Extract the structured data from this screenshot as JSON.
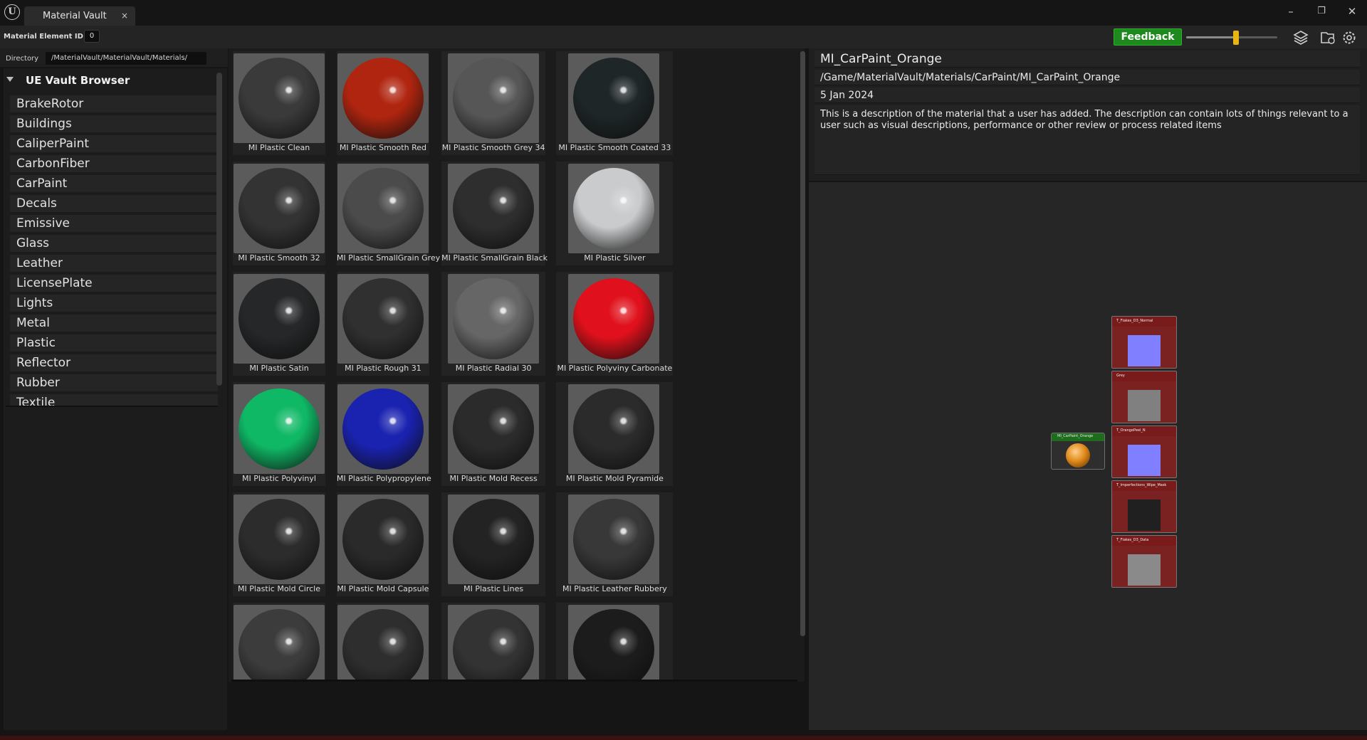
{
  "window": {
    "tab_title": "Material Vault",
    "tab_close": "×",
    "controls": {
      "minimize": "–",
      "restore": "❐",
      "close": "✕"
    }
  },
  "toolbar": {
    "material_element_id_label": "Material Element ID :",
    "material_element_id_value": "0",
    "feedback_label": "Feedback",
    "zoom_slider_level": 0.55
  },
  "directory": {
    "label": "Directory",
    "value": "/MaterialVault/MaterialVault/Materials/"
  },
  "sidebar": {
    "title": "UE Vault Browser",
    "items": [
      "BrakeRotor",
      "Buildings",
      "CaliperPaint",
      "CarbonFiber",
      "CarPaint",
      "Decals",
      "Emissive",
      "Glass",
      "Leather",
      "LicensePlate",
      "Lights",
      "Metal",
      "Plastic",
      "Reflector",
      "Rubber",
      "Textile"
    ]
  },
  "grid": {
    "rows": [
      [
        {
          "label": "MI Plastic Clean",
          "color": "#3a3a3a"
        },
        {
          "label": "MI Plastic Smooth Red",
          "color": "#b0250f"
        },
        {
          "label": "MI Plastic Smooth Grey 34",
          "color": "#565656"
        },
        {
          "label": "MI Plastic Smooth Coated 33",
          "color": "#1e2628"
        }
      ],
      [
        {
          "label": "MI Plastic Smooth 32",
          "color": "#333333"
        },
        {
          "label": "MI Plastic SmallGrain Grey",
          "color": "#4b4b4b"
        },
        {
          "label": "MI Plastic SmallGrain Black",
          "color": "#2e2e2e"
        },
        {
          "label": "MI Plastic Silver",
          "color": "#c9cbcc"
        }
      ],
      [
        {
          "label": "MI Plastic Satin",
          "color": "#252728"
        },
        {
          "label": "MI Plastic Rough 31",
          "color": "#303030"
        },
        {
          "label": "MI Plastic Radial 30",
          "color": "#666666"
        },
        {
          "label": "MI Plastic Polyviny Carbonate",
          "color": "#e0111c"
        }
      ],
      [
        {
          "label": "MI Plastic Polyvinyl",
          "color": "#0fb865"
        },
        {
          "label": "MI Plastic Polypropylene",
          "color": "#1a22b0"
        },
        {
          "label": "MI Plastic Mold Recess",
          "color": "#2b2b2b"
        },
        {
          "label": "MI Plastic Mold Pyramide",
          "color": "#2b2b2b"
        }
      ],
      [
        {
          "label": "MI Plastic Mold Circle",
          "color": "#2c2c2c"
        },
        {
          "label": "MI Plastic Mold Capsule",
          "color": "#2a2a2a"
        },
        {
          "label": "MI Plastic Lines",
          "color": "#232323"
        },
        {
          "label": "MI Plastic Leather Rubbery",
          "color": "#383838"
        }
      ],
      [
        {
          "label": "",
          "color": "#3c3c3c"
        },
        {
          "label": "",
          "color": "#2e2e2e"
        },
        {
          "label": "",
          "color": "#333333"
        },
        {
          "label": "",
          "color": "#1c1c1c"
        }
      ]
    ]
  },
  "details": {
    "name": "MI_CarPaint_Orange",
    "path": "/Game/MaterialVault/Materials/CarPaint/MI_CarPaint_Orange",
    "date": "5 Jan 2024",
    "description": "This is a description of the material that a user has added. The description can contain lots of things relevant to a user such as visual descriptions, performance or other review or process related items"
  },
  "graph": {
    "material_node": {
      "title": "MI_CarPaint_Orange",
      "color": "#e08a1a"
    },
    "texture_nodes": [
      {
        "title": "T_Flakes_D3_Normal",
        "preview": "#7f7fff"
      },
      {
        "title": "Grey",
        "preview": "#808080"
      },
      {
        "title": "T_OrangePeel_N",
        "preview": "#7f7fff"
      },
      {
        "title": "T_Imperfections_Wipe_Mask",
        "preview": "#202020"
      },
      {
        "title": "T_Flakes_D3_Data",
        "preview": "#8a8a8a"
      }
    ]
  },
  "colors": {
    "accent": "#1e8a1e",
    "slider": "#e8b514",
    "node_header": "#7a1b1b"
  }
}
